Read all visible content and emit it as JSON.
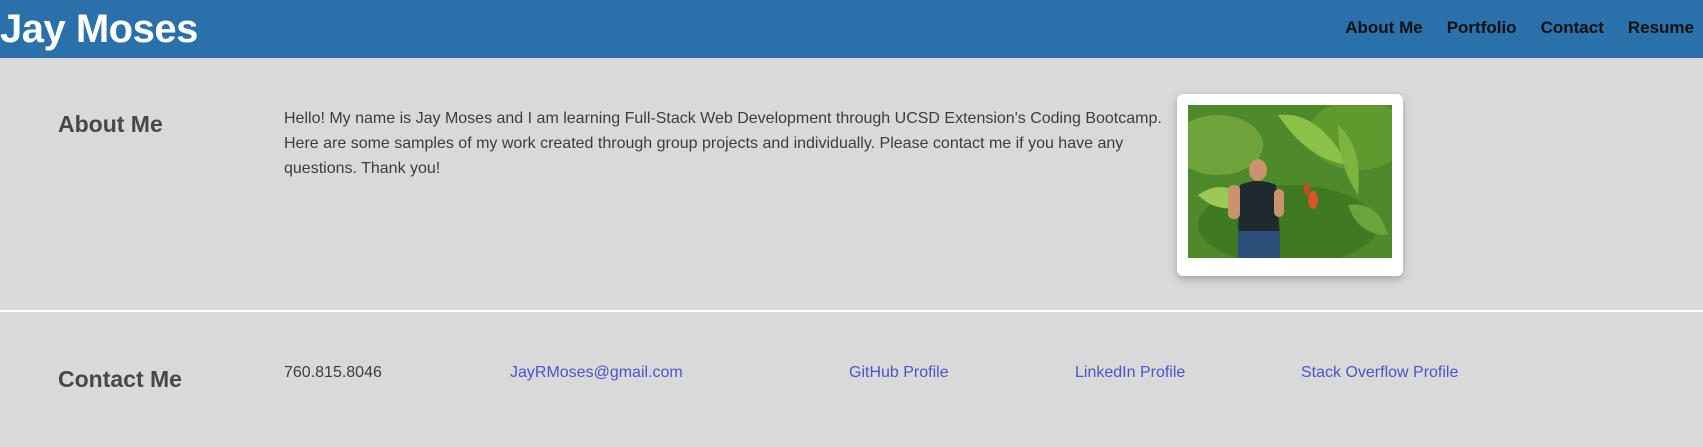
{
  "header": {
    "brand": "Jay Moses",
    "nav": [
      "About Me",
      "Portfolio",
      "Contact",
      "Resume"
    ],
    "background_color": "#2a70aa"
  },
  "about": {
    "title": "About Me",
    "text": "Hello! My name is Jay Moses and I am learning Full-Stack Web Development through UCSD Extension's Coding Bootcamp. Here are some samples of my work created through group projects and individually. Please contact me if you have any questions. Thank you!",
    "photo_icon": "profile-photo"
  },
  "contact": {
    "title": "Contact Me",
    "phone": "760.815.8046",
    "email": "JayRMoses@gmail.com",
    "github": "GitHub Profile",
    "linkedin": "LinkedIn Profile",
    "stackoverflow": "Stack Overflow Profile",
    "link_color": "#4c55c8"
  },
  "colors": {
    "section_background": "#d9d9d9",
    "heading": "#484848"
  }
}
